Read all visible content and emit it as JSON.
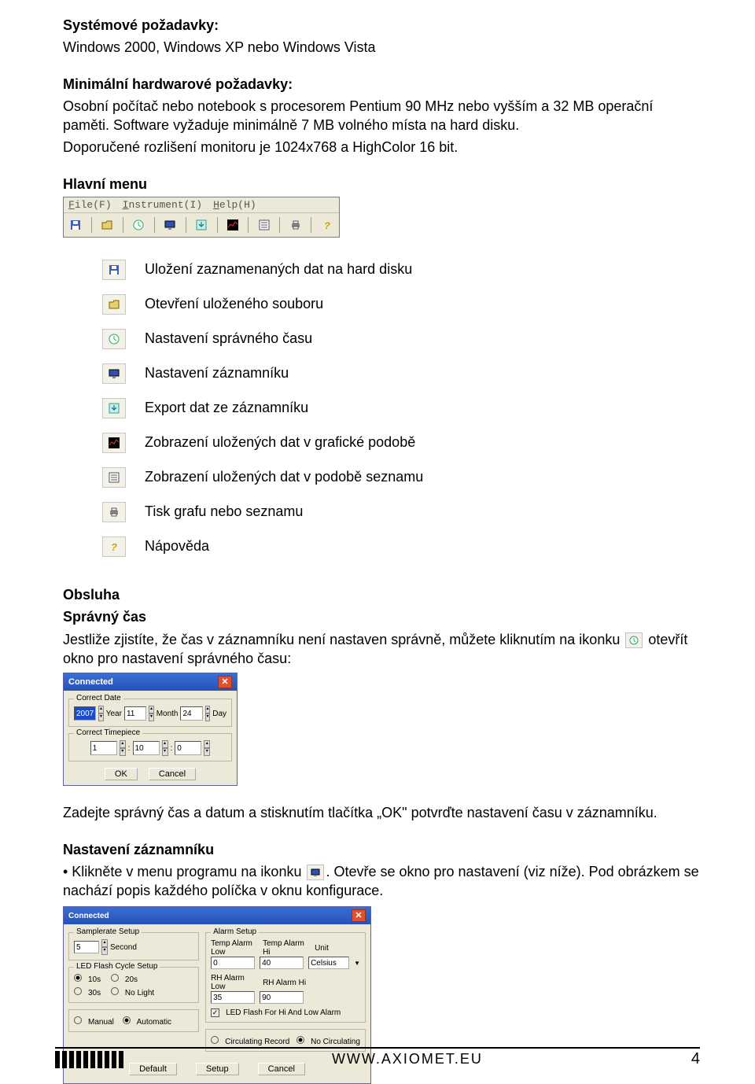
{
  "headings": {
    "sys_req": "Systémové požadavky:",
    "hw_req": "Minimální hardwarové požadavky:",
    "main_menu": "Hlavní menu",
    "obsluha": "Obsluha",
    "spravny_cas": "Správný čas",
    "nast_zaznamniku": "Nastavení záznamníku"
  },
  "text": {
    "sys_req_body": "Windows 2000, Windows XP nebo Windows Vista",
    "hw_req_body1": "Osobní počítač nebo notebook s procesorem Pentium 90 MHz nebo vyšším a 32 MB operační paměti. Software vyžaduje minimálně 7 MB volného místa na hard disku.",
    "hw_req_body2": "Doporučené rozlišení monitoru je 1024x768 a HighColor 16 bit.",
    "spravny_cas_p1_a": "Jestliže zjistíte, že čas v záznamníku není nastaven správně, můžete kliknutím na ikonku ",
    "spravny_cas_p1_b": " otevřít okno pro nastavení správného času:",
    "zadejte": "Zadejte správný čas a datum a stisknutím tlačítka „OK\" potvrďte nastavení času v záznamníku.",
    "nast_bullet_a": "• Klikněte v menu programu na ikonku ",
    "nast_bullet_b": ". Otevře se okno pro nastavení (viz níže). Pod obrázkem se nachází popis každého políčka v oknu konfigurace."
  },
  "toolbar_menu": {
    "file": "File(F)",
    "instrument": "Instrument(I)",
    "help": "Help(H)"
  },
  "icon_list": [
    "Uložení zaznamenaných dat na hard disku",
    "Otevření uloženého souboru",
    "Nastavení správného času",
    "Nastavení záznamníku",
    "Export dat ze záznamníku",
    "Zobrazení uložených dat v grafické podobě",
    "Zobrazení uložených dat v podobě seznamu",
    "Tisk grafu nebo seznamu",
    "Nápověda"
  ],
  "dlg_time": {
    "title": "Connected",
    "group_date": "Correct Date",
    "group_time": "Correct Timepiece",
    "year_val": "2007",
    "year_lbl": "Year",
    "month_val": "11",
    "month_lbl": "Month",
    "day_val": "24",
    "day_lbl": "Day",
    "h_val": "1",
    "m_val": "10",
    "s_val": "0",
    "ok": "OK",
    "cancel": "Cancel"
  },
  "dlg_setup": {
    "title": "Connected",
    "grp_samplerate": "Samplerate Setup",
    "sample_val": "5",
    "sample_unit": "Second",
    "grp_led": "LED Flash Cycle Setup",
    "r10s": "10s",
    "r20s": "20s",
    "r30s": "30s",
    "r_nolight": "No Light",
    "grp_manauto": "",
    "r_manual": "Manual",
    "r_auto": "Automatic",
    "btn_default": "Default",
    "btn_setup": "Setup",
    "btn_cancel": "Cancel",
    "grp_alarm": "Alarm Setup",
    "t_low_lbl": "Temp Alarm Low",
    "t_hi_lbl": "Temp Alarm Hi",
    "t_unit": "Unit",
    "t_low_val": "0",
    "t_hi_val": "40",
    "t_unit_val": "Celsius",
    "rh_low_lbl": "RH Alarm Low",
    "rh_hi_lbl": "RH Alarm Hi",
    "rh_low_val": "35",
    "rh_hi_val": "90",
    "chk_ledflash": "LED Flash For Hi And Low Alarm",
    "grp_circ": "",
    "r_circrec": "Circulating Record",
    "r_nocirc": "No Circulating"
  },
  "footer": {
    "url": "WWW.AXIOMET.EU",
    "page": "4"
  }
}
